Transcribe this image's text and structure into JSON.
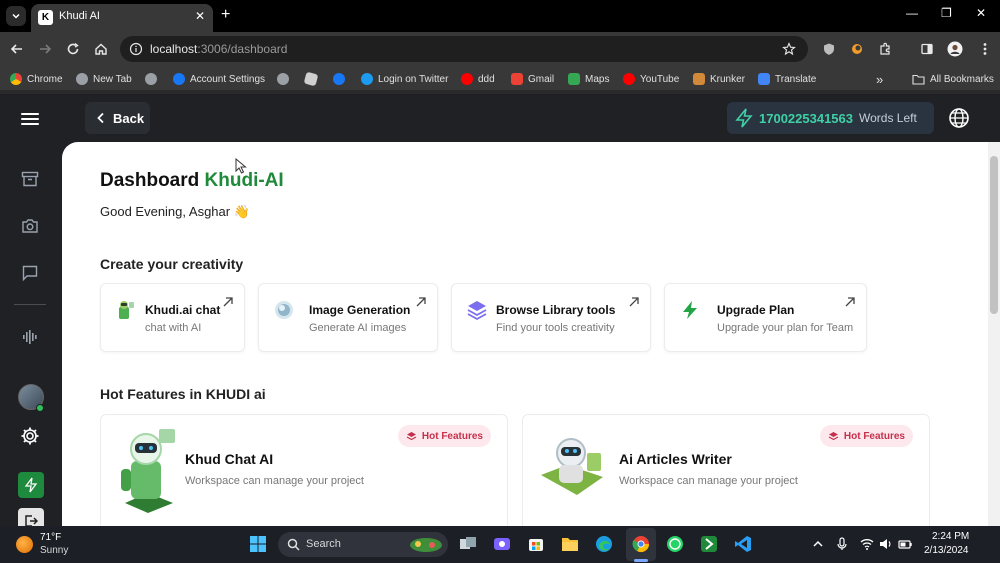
{
  "browser": {
    "tab_title": "Khudi AI",
    "tab_favicon": "K",
    "url_host": "localhost",
    "url_path": ":3006/dashboard",
    "window_controls": {
      "minimize": "—",
      "maximize": "❐",
      "close": "✕"
    },
    "bookmarks": [
      {
        "label": "Chrome",
        "icon": "chrome-icon",
        "color": "#8ab4f8"
      },
      {
        "label": "New Tab",
        "icon": "globe-icon",
        "color": "#9aa0a6"
      },
      {
        "label": "",
        "icon": "globe-icon",
        "color": "#9aa0a6"
      },
      {
        "label": "Account Settings",
        "icon": "facebook-icon",
        "color": "#1877f2"
      },
      {
        "label": "",
        "icon": "globe-icon",
        "color": "#9aa0a6"
      },
      {
        "label": "",
        "icon": "roblox-icon",
        "color": "#9aa0a6"
      },
      {
        "label": "",
        "icon": "facebook-icon",
        "color": "#1877f2"
      },
      {
        "label": "Login on Twitter",
        "icon": "twitter-icon",
        "color": "#1d9bf0"
      },
      {
        "label": "ddd",
        "icon": "youtube-icon",
        "color": "#ff0000"
      },
      {
        "label": "Gmail",
        "icon": "gmail-icon",
        "color": "#ea4335"
      },
      {
        "label": "Maps",
        "icon": "maps-icon",
        "color": "#34a853"
      },
      {
        "label": "YouTube",
        "icon": "youtube-icon",
        "color": "#ff0000"
      },
      {
        "label": "Krunker",
        "icon": "krunker-icon",
        "color": "#d08a3a"
      },
      {
        "label": "Translate",
        "icon": "translate-icon",
        "color": "#4285f4"
      }
    ],
    "bookmarks_overflow": "»",
    "all_bookmarks": "All Bookmarks"
  },
  "header": {
    "back_label": "Back",
    "words_count": "1700225341563",
    "words_label": "Words Left"
  },
  "page": {
    "title_prefix": "Dashboard",
    "title_brand": "Khudi-AI",
    "greeting": "Good Evening, Asghar 👋",
    "section_create": "Create your creativity",
    "section_hot": "Hot Features in KHUDI ai"
  },
  "quick_cards": [
    {
      "title": "Khudi.ai chat",
      "subtitle": "chat with AI",
      "icon": "robot-chat-icon"
    },
    {
      "title": "Image Generation",
      "subtitle": "Generate AI images",
      "icon": "image-generation-icon"
    },
    {
      "title": "Browse Library tools",
      "subtitle": "Find your tools creativity",
      "icon": "layers-icon"
    },
    {
      "title": "Upgrade Plan",
      "subtitle": "Upgrade your plan for Team",
      "icon": "bolt-icon"
    }
  ],
  "features": [
    {
      "title": "Khud Chat AI",
      "subtitle": "Workspace can manage your project",
      "badge": "Hot Features"
    },
    {
      "title": "Ai Articles Writer",
      "subtitle": "Workspace can manage your project",
      "badge": "Hot Features"
    }
  ],
  "taskbar": {
    "weather_temp": "71°F",
    "weather_desc": "Sunny",
    "search_label": "Search",
    "time": "2:24 PM",
    "date": "2/13/2024"
  },
  "colors": {
    "brand_green": "#1f8a3a",
    "words_teal": "#3fd0a6",
    "hot_badge_bg": "#fde8ee",
    "hot_badge_text": "#c4314b"
  }
}
